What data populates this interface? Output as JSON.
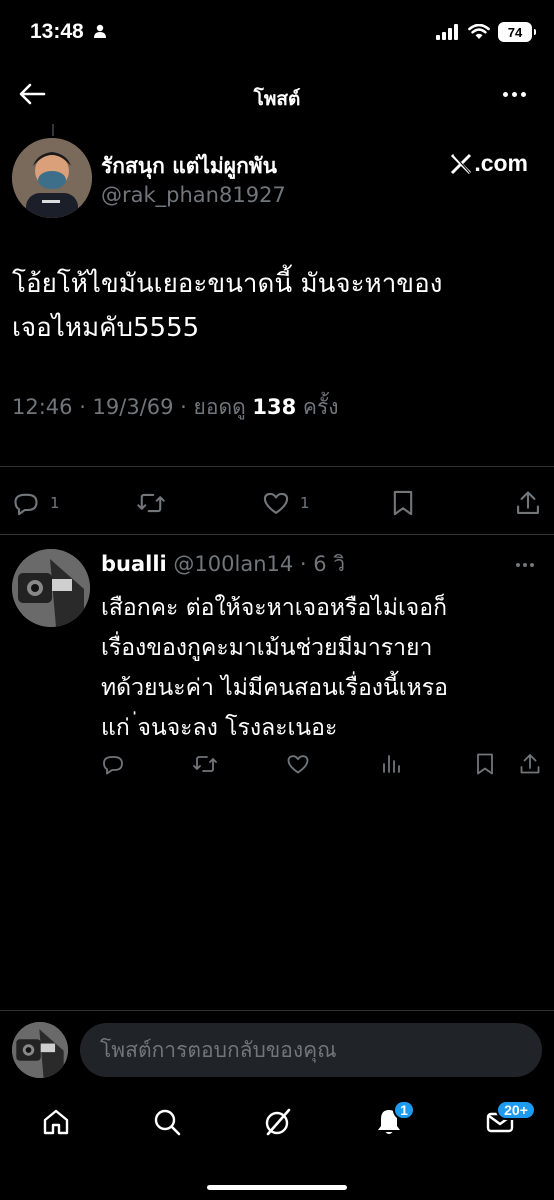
{
  "status_bar": {
    "time": "13:48",
    "battery": "74"
  },
  "header": {
    "title": "โพสต์"
  },
  "post": {
    "author_name": "รักสนุก แต่ไม่ผูกพัน",
    "author_handle": "@rak_phan81927",
    "source_badge": ".com",
    "text_line1": "โอ้ยโห้ไขมันเยอะขนาดนี้ มันจะหาของ",
    "text_line2": "เจอไหมคับ5555",
    "time": "12:46 · 19/3/69 · ยอดดู ",
    "views": "138",
    "views_suffix": " ครั้ง",
    "reply_count": "1",
    "like_count": "1"
  },
  "reply": {
    "name": "bualli",
    "handle_time": " @100lan14 · 6 วิ",
    "line1": "เสือกคะ ต่อให้จะหาเจอหรือไม่เจอก็",
    "line2": "เรื่องของกูคะมาเม้นช่วยมีมารายา",
    "line3": "ทด้วยนะค่า ไม่มีคนสอนเรื่องนี้เหรอ",
    "line4": "แก่ ่จนจะลง โรงละเนอะ"
  },
  "composer": {
    "placeholder": "โพสต์การตอบกลับของคุณ"
  },
  "bottom_nav": {
    "notifications_badge": "1",
    "messages_badge": "20+"
  },
  "colors": {
    "background": "#000000",
    "muted": "#71767b",
    "accent": "#1d9bf0",
    "divider": "#2f3336"
  },
  "icons": [
    "back-arrow-icon",
    "more-dots-icon",
    "x-logo-icon",
    "reply-icon",
    "repost-icon",
    "like-icon",
    "bookmark-icon",
    "share-icon",
    "views-icon",
    "home-icon",
    "search-icon",
    "grok-icon",
    "bell-icon",
    "mail-icon",
    "signal-icon",
    "wifi-icon",
    "person-icon"
  ]
}
